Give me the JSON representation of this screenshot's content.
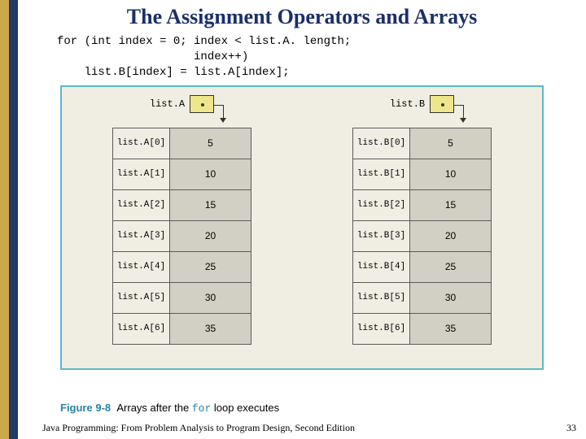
{
  "title": "The Assignment Operators and Arrays",
  "code": {
    "line1": "for (int index = 0; index < list.A. length;",
    "line2": "                    index++)",
    "line3": "    list.B[index] = list.A[index];"
  },
  "arrays": {
    "left": {
      "var": "list.A",
      "cells": [
        {
          "label": "list.A[0]",
          "value": "5"
        },
        {
          "label": "list.A[1]",
          "value": "10"
        },
        {
          "label": "list.A[2]",
          "value": "15"
        },
        {
          "label": "list.A[3]",
          "value": "20"
        },
        {
          "label": "list.A[4]",
          "value": "25"
        },
        {
          "label": "list.A[5]",
          "value": "30"
        },
        {
          "label": "list.A[6]",
          "value": "35"
        }
      ]
    },
    "right": {
      "var": "list.B",
      "cells": [
        {
          "label": "list.B[0]",
          "value": "5"
        },
        {
          "label": "list.B[1]",
          "value": "10"
        },
        {
          "label": "list.B[2]",
          "value": "15"
        },
        {
          "label": "list.B[3]",
          "value": "20"
        },
        {
          "label": "list.B[4]",
          "value": "25"
        },
        {
          "label": "list.B[5]",
          "value": "30"
        },
        {
          "label": "list.B[6]",
          "value": "35"
        }
      ]
    }
  },
  "caption": {
    "fignum": "Figure 9-8",
    "before": "Arrays after the ",
    "keyword": "for",
    "after": " loop executes"
  },
  "footer": "Java Programming: From Problem Analysis to Program Design, Second Edition",
  "pagenum": "33"
}
